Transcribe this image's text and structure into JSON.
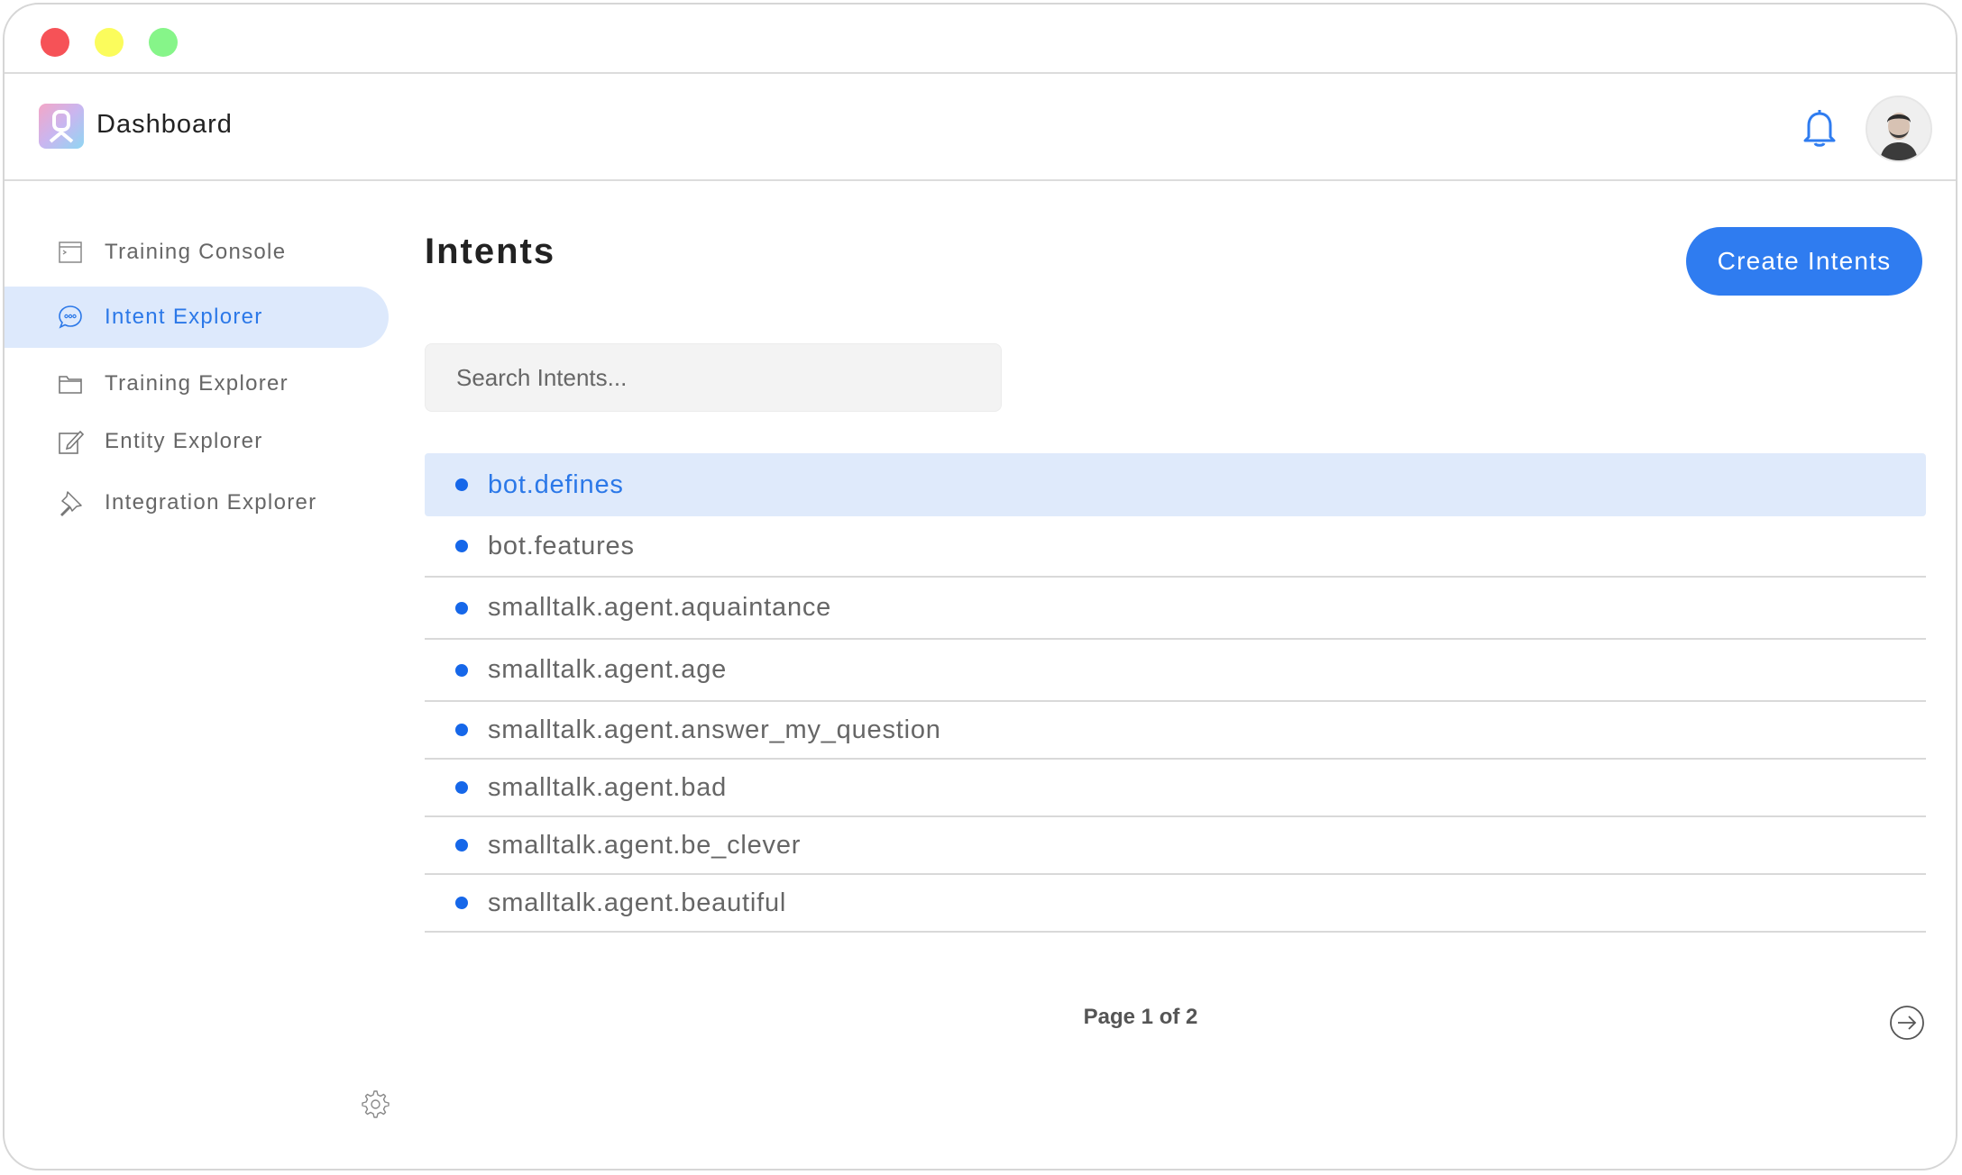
{
  "window": {
    "controls": [
      "close",
      "minimize",
      "maximize"
    ]
  },
  "header": {
    "logo_icon": "app-logo-icon",
    "title": "Dashboard",
    "bell_icon": "bell-icon",
    "avatar": "user-avatar"
  },
  "sidebar": {
    "items": [
      {
        "label": "Training Console",
        "icon": "console-icon",
        "active": false
      },
      {
        "label": "Intent Explorer",
        "icon": "chat-bubble-icon",
        "active": true
      },
      {
        "label": "Training Explorer",
        "icon": "folder-icon",
        "active": false
      },
      {
        "label": "Entity Explorer",
        "icon": "edit-icon",
        "active": false
      },
      {
        "label": "Integration Explorer",
        "icon": "pin-icon",
        "active": false
      }
    ],
    "settings_icon": "gear-icon"
  },
  "main": {
    "title": "Intents",
    "create_button": "Create Intents",
    "search_placeholder": "Search Intents...",
    "intents": [
      "bot.defines",
      "bot.features",
      "smalltalk.agent.aquaintance",
      "smalltalk.agent.age",
      "smalltalk.agent.answer_my_question",
      "smalltalk.agent.bad",
      "smalltalk.agent.be_clever",
      "smalltalk.agent.beautiful"
    ],
    "selected_index": 0,
    "pagination": "Page 1 of 2",
    "next_icon": "arrow-right-circle-icon"
  },
  "colors": {
    "accent": "#2f7cf0",
    "selected_bg": "#dde9fc",
    "bullet": "#1667e9"
  }
}
